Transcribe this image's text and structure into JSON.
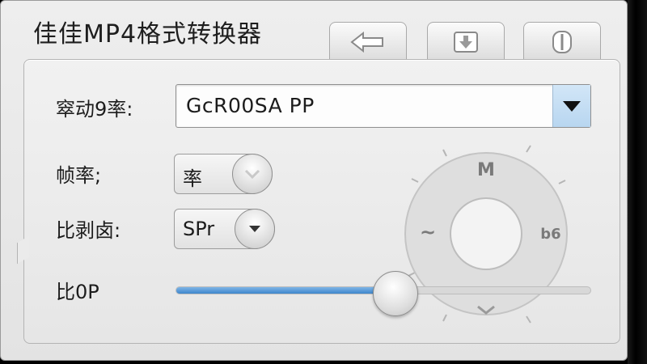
{
  "window": {
    "title": "佳佳MP4格式转换器",
    "tabs": [
      {
        "icon": "arrow-left-icon"
      },
      {
        "icon": "download-icon"
      },
      {
        "icon": "pause-icon"
      }
    ]
  },
  "form": {
    "codec": {
      "label": "窣动9率:",
      "value": "GcR00SA PP"
    },
    "fps": {
      "label": "帧率;",
      "value": "率"
    },
    "ratio": {
      "label": "比剥卤:",
      "value": "SPr"
    },
    "slider": {
      "label": "比0P",
      "level": 0.53
    }
  },
  "wheel": {
    "top": "M",
    "right": "b6",
    "left": "~"
  },
  "colors": {
    "accent": "#4a90d9",
    "window_bg": "#e9e9e9"
  }
}
